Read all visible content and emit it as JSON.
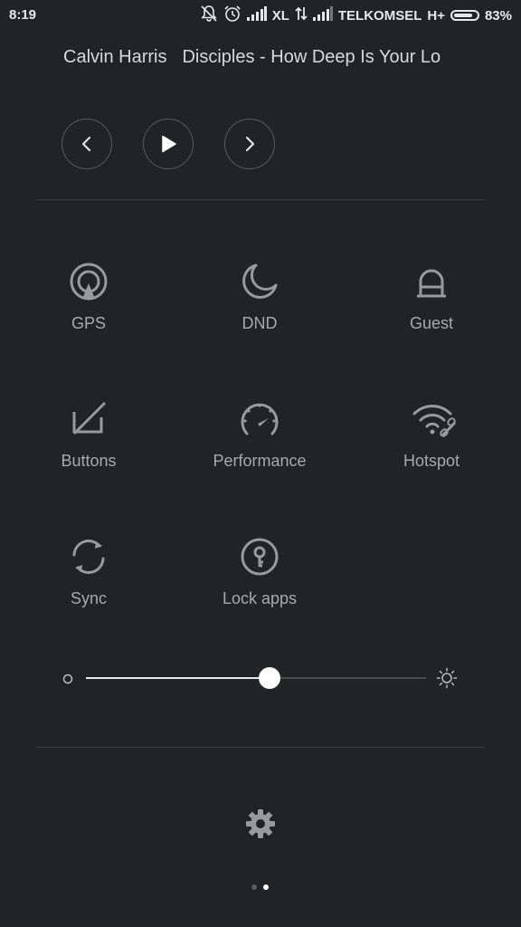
{
  "status_bar": {
    "time": "8:19",
    "carrier1": "XL",
    "carrier2": "TELKOMSEL",
    "network_type": "H+",
    "battery": "83%"
  },
  "music": {
    "artist": "Calvin Harris",
    "track": "Disciples - How Deep Is Your Lo"
  },
  "tiles": [
    {
      "label": "GPS",
      "icon": "gps-icon"
    },
    {
      "label": "DND",
      "icon": "moon-icon"
    },
    {
      "label": "Guest",
      "icon": "guest-icon"
    },
    {
      "label": "Buttons",
      "icon": "buttons-off-icon"
    },
    {
      "label": "Performance",
      "icon": "speedometer-icon"
    },
    {
      "label": "Hotspot",
      "icon": "hotspot-icon"
    },
    {
      "label": "Sync",
      "icon": "sync-icon"
    },
    {
      "label": "Lock apps",
      "icon": "lock-apps-icon"
    }
  ],
  "brightness": {
    "level": 0.54
  },
  "pager": {
    "count": 2,
    "active": 1
  },
  "colors": {
    "background": "#222325",
    "icon": "#9a9a9a",
    "label": "#a9a9a9",
    "accent": "#ffffff"
  }
}
